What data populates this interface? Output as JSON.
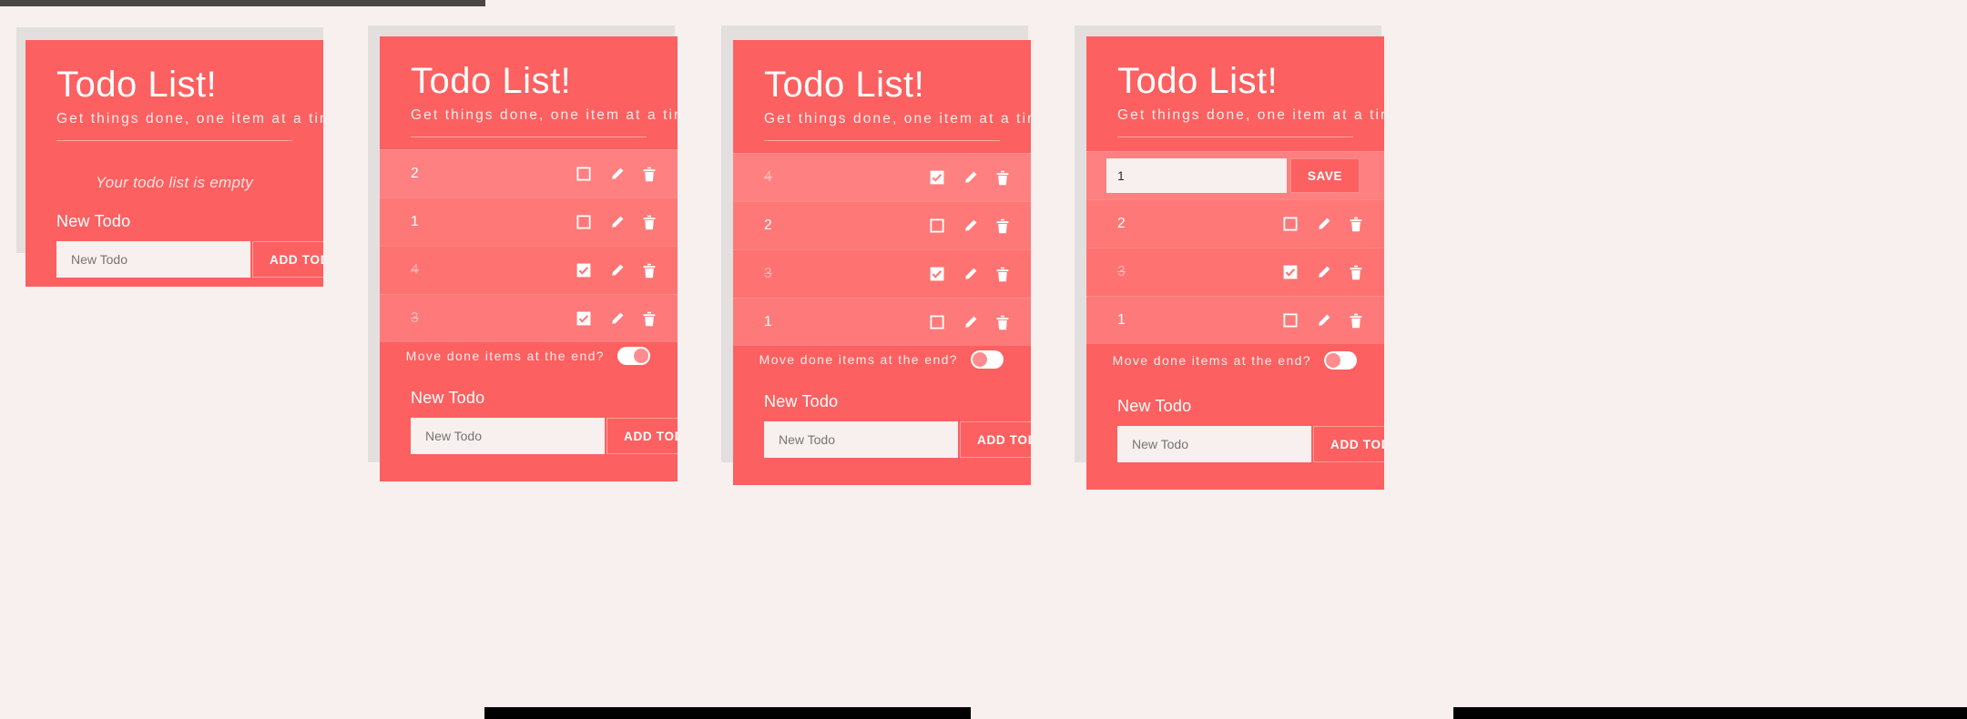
{
  "theme": {
    "page_background": "#f7f0ef",
    "card_accent": "#fc6060",
    "row_band": "#ff8080",
    "shadow_card": "#e3dfde",
    "text_on_accent": "#ffffff"
  },
  "app": {
    "title": "Todo List!",
    "subtitle": "Get things done, one item at a time.",
    "empty_message": "Your todo list is empty",
    "new_todo_label": "New Todo",
    "new_todo_placeholder": "New Todo",
    "add_button": "ADD TODO",
    "save_button": "SAVE",
    "move_done_label": "Move done items at the end?"
  },
  "icons": {
    "checkbox_unchecked": "checkbox-unchecked-icon",
    "checkbox_checked": "checkbox-checked-icon",
    "edit": "pencil-icon",
    "delete": "trash-icon",
    "toggle": "toggle-switch"
  },
  "panels": [
    {
      "id": "panel-empty",
      "state": "empty",
      "items": [],
      "has_toggle": false,
      "toggle_on": false,
      "edit": null
    },
    {
      "id": "panel-sorted-done-last",
      "state": "list",
      "items": [
        {
          "text": "2",
          "done": false
        },
        {
          "text": "1",
          "done": false
        },
        {
          "text": "4",
          "done": true
        },
        {
          "text": "3",
          "done": true
        }
      ],
      "has_toggle": true,
      "toggle_on": true,
      "edit": null
    },
    {
      "id": "panel-unsorted",
      "state": "list",
      "items": [
        {
          "text": "4",
          "done": true
        },
        {
          "text": "2",
          "done": false
        },
        {
          "text": "3",
          "done": true
        },
        {
          "text": "1",
          "done": false
        }
      ],
      "has_toggle": true,
      "toggle_on": false,
      "edit": null
    },
    {
      "id": "panel-editing",
      "state": "list",
      "items": [
        {
          "text": "2",
          "done": false
        },
        {
          "text": "3",
          "done": true
        },
        {
          "text": "1",
          "done": false
        }
      ],
      "has_toggle": true,
      "toggle_on": false,
      "edit": {
        "value": "1",
        "button": "SAVE"
      }
    }
  ]
}
